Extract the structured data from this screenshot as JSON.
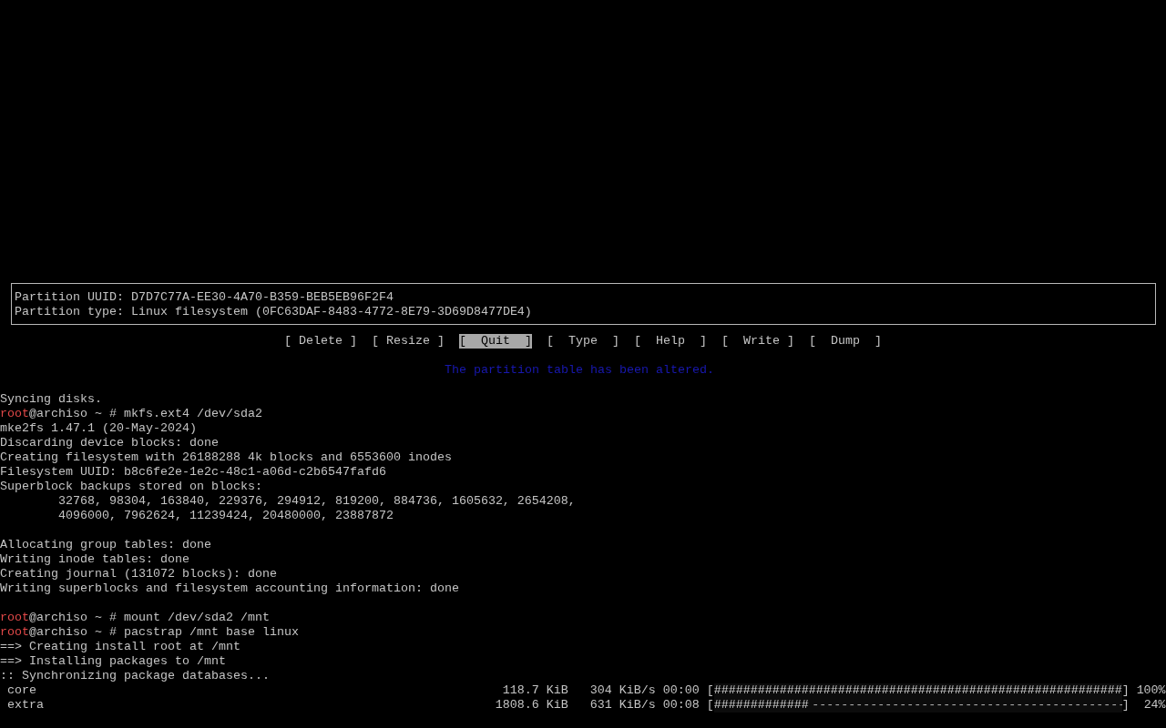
{
  "partition_info": {
    "lines": [
      "Partition UUID: D7D7C77A-EE30-4A70-B359-BEB5EB96F2F4",
      "Partition type: Linux filesystem (0FC63DAF-8483-4772-8E79-3D69D8477DE4)"
    ]
  },
  "menu": [
    {
      "label": "[ Delete ]",
      "selected": false
    },
    {
      "label": "[ Resize ]",
      "selected": false
    },
    {
      "label": "[  Quit  ]",
      "selected": true
    },
    {
      "label": "[  Type  ]",
      "selected": false
    },
    {
      "label": "[  Help  ]",
      "selected": false
    },
    {
      "label": "[  Write ]",
      "selected": false
    },
    {
      "label": "[  Dump  ]",
      "selected": false
    }
  ],
  "status_message": "The partition table has been altered.",
  "console": [
    {
      "kind": "text",
      "text": "Syncing disks."
    },
    {
      "kind": "prompt",
      "user": "root",
      "host": "@archiso ~ #",
      "command": "mkfs.ext4 /dev/sda2"
    },
    {
      "kind": "text",
      "text": "mke2fs 1.47.1 (20-May-2024)"
    },
    {
      "kind": "text",
      "text": "Discarding device blocks: done"
    },
    {
      "kind": "text",
      "text": "Creating filesystem with 26188288 4k blocks and 6553600 inodes"
    },
    {
      "kind": "text",
      "text": "Filesystem UUID: b8c6fe2e-1e2c-48c1-a06d-c2b6547fafd6"
    },
    {
      "kind": "text",
      "text": "Superblock backups stored on blocks:"
    },
    {
      "kind": "indented",
      "text": "32768, 98304, 163840, 229376, 294912, 819200, 884736, 1605632, 2654208,"
    },
    {
      "kind": "indented",
      "text": "4096000, 7962624, 11239424, 20480000, 23887872"
    },
    {
      "kind": "blank"
    },
    {
      "kind": "text",
      "text": "Allocating group tables: done"
    },
    {
      "kind": "text",
      "text": "Writing inode tables: done"
    },
    {
      "kind": "text",
      "text": "Creating journal (131072 blocks): done"
    },
    {
      "kind": "text",
      "text": "Writing superblocks and filesystem accounting information: done"
    },
    {
      "kind": "blank"
    },
    {
      "kind": "prompt",
      "user": "root",
      "host": "@archiso ~ #",
      "command": "mount /dev/sda2 /mnt"
    },
    {
      "kind": "prompt",
      "user": "root",
      "host": "@archiso ~ #",
      "command": "pacstrap /mnt base linux"
    },
    {
      "kind": "text",
      "text": "==> Creating install root at /mnt"
    },
    {
      "kind": "text",
      "text": "==> Installing packages to /mnt"
    },
    {
      "kind": "text",
      "text": ":: Synchronizing package databases..."
    },
    {
      "kind": "progress",
      "name": "core",
      "size": "118.7 KiB",
      "rate": "304 KiB/s",
      "time": "00:00",
      "level": 1,
      "bar": "[########################################################]",
      "percent": "100%"
    },
    {
      "kind": "progress",
      "name": "extra",
      "size": "1808.6 KiB",
      "rate": "631 KiB/s",
      "time": "00:08",
      "level": 0.24,
      "bar": "[#############-------------------------------------------]",
      "percent": "24%"
    }
  ]
}
